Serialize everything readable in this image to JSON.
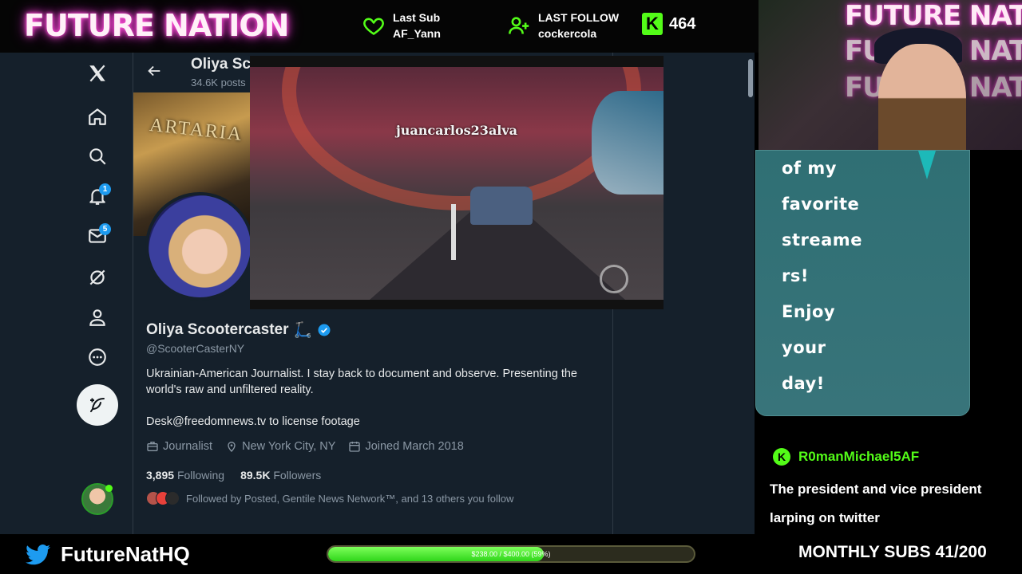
{
  "overlay": {
    "brand": "FUTURE NATION",
    "last_sub_title": "Last Sub",
    "last_sub_name": "AF_Yann",
    "last_follow_title": "LAST FOLLOW",
    "last_follow_name": "cockercola",
    "kick_logo_letter": "K",
    "kick_count": "464",
    "twitter_handle": "FutureNatHQ",
    "progress_text": "$238.00 / $400.00 (59%)",
    "progress_fraction": 0.59,
    "monthly_subs": "MONTHLY SUBS 41/200",
    "accent_green": "#53fc18",
    "brand_pink": "#ff4fd8"
  },
  "twitter": {
    "nav": [
      {
        "name": "x-logo-icon"
      },
      {
        "name": "home-icon"
      },
      {
        "name": "search-icon"
      },
      {
        "name": "notifications-icon",
        "badge": "1"
      },
      {
        "name": "messages-icon",
        "badge": "5"
      },
      {
        "name": "grok-icon"
      },
      {
        "name": "profile-icon"
      },
      {
        "name": "more-icon"
      }
    ],
    "header_name": "Oliya Scootercaster",
    "header_posts": "34.6K posts",
    "banner_sign": "ARTARIA",
    "profile": {
      "name": "Oliya Scootercaster",
      "emoji": "🛴",
      "handle": "@ScooterCasterNY",
      "bio": "Ukrainian-American Journalist. I stay back to document and observe. Presenting the world's raw and unfiltered reality.",
      "desk": "Desk@freedomnews.tv to license footage",
      "profession": "Journalist",
      "location": "New York City, NY",
      "joined": "Joined March 2018",
      "following_count": "3,895",
      "following_label": "Following",
      "followers_count": "89.5K",
      "followers_label": "Followers",
      "followed_by": "Followed by Posted, Gentile News Network™, and 13 others you follow"
    },
    "accent_blue": "#1d9bf0"
  },
  "video": {
    "watermark": "juancarlos23alva"
  },
  "webcam": {
    "sign_text": "FUTURE NATION"
  },
  "bubble": {
    "lines": [
      "of my",
      "favorite",
      "streame",
      "rs!",
      "Enjoy",
      "your",
      "day!"
    ]
  },
  "chat": {
    "username": "R0manMichael5AF",
    "message": "The president and vice president larping on twitter"
  }
}
